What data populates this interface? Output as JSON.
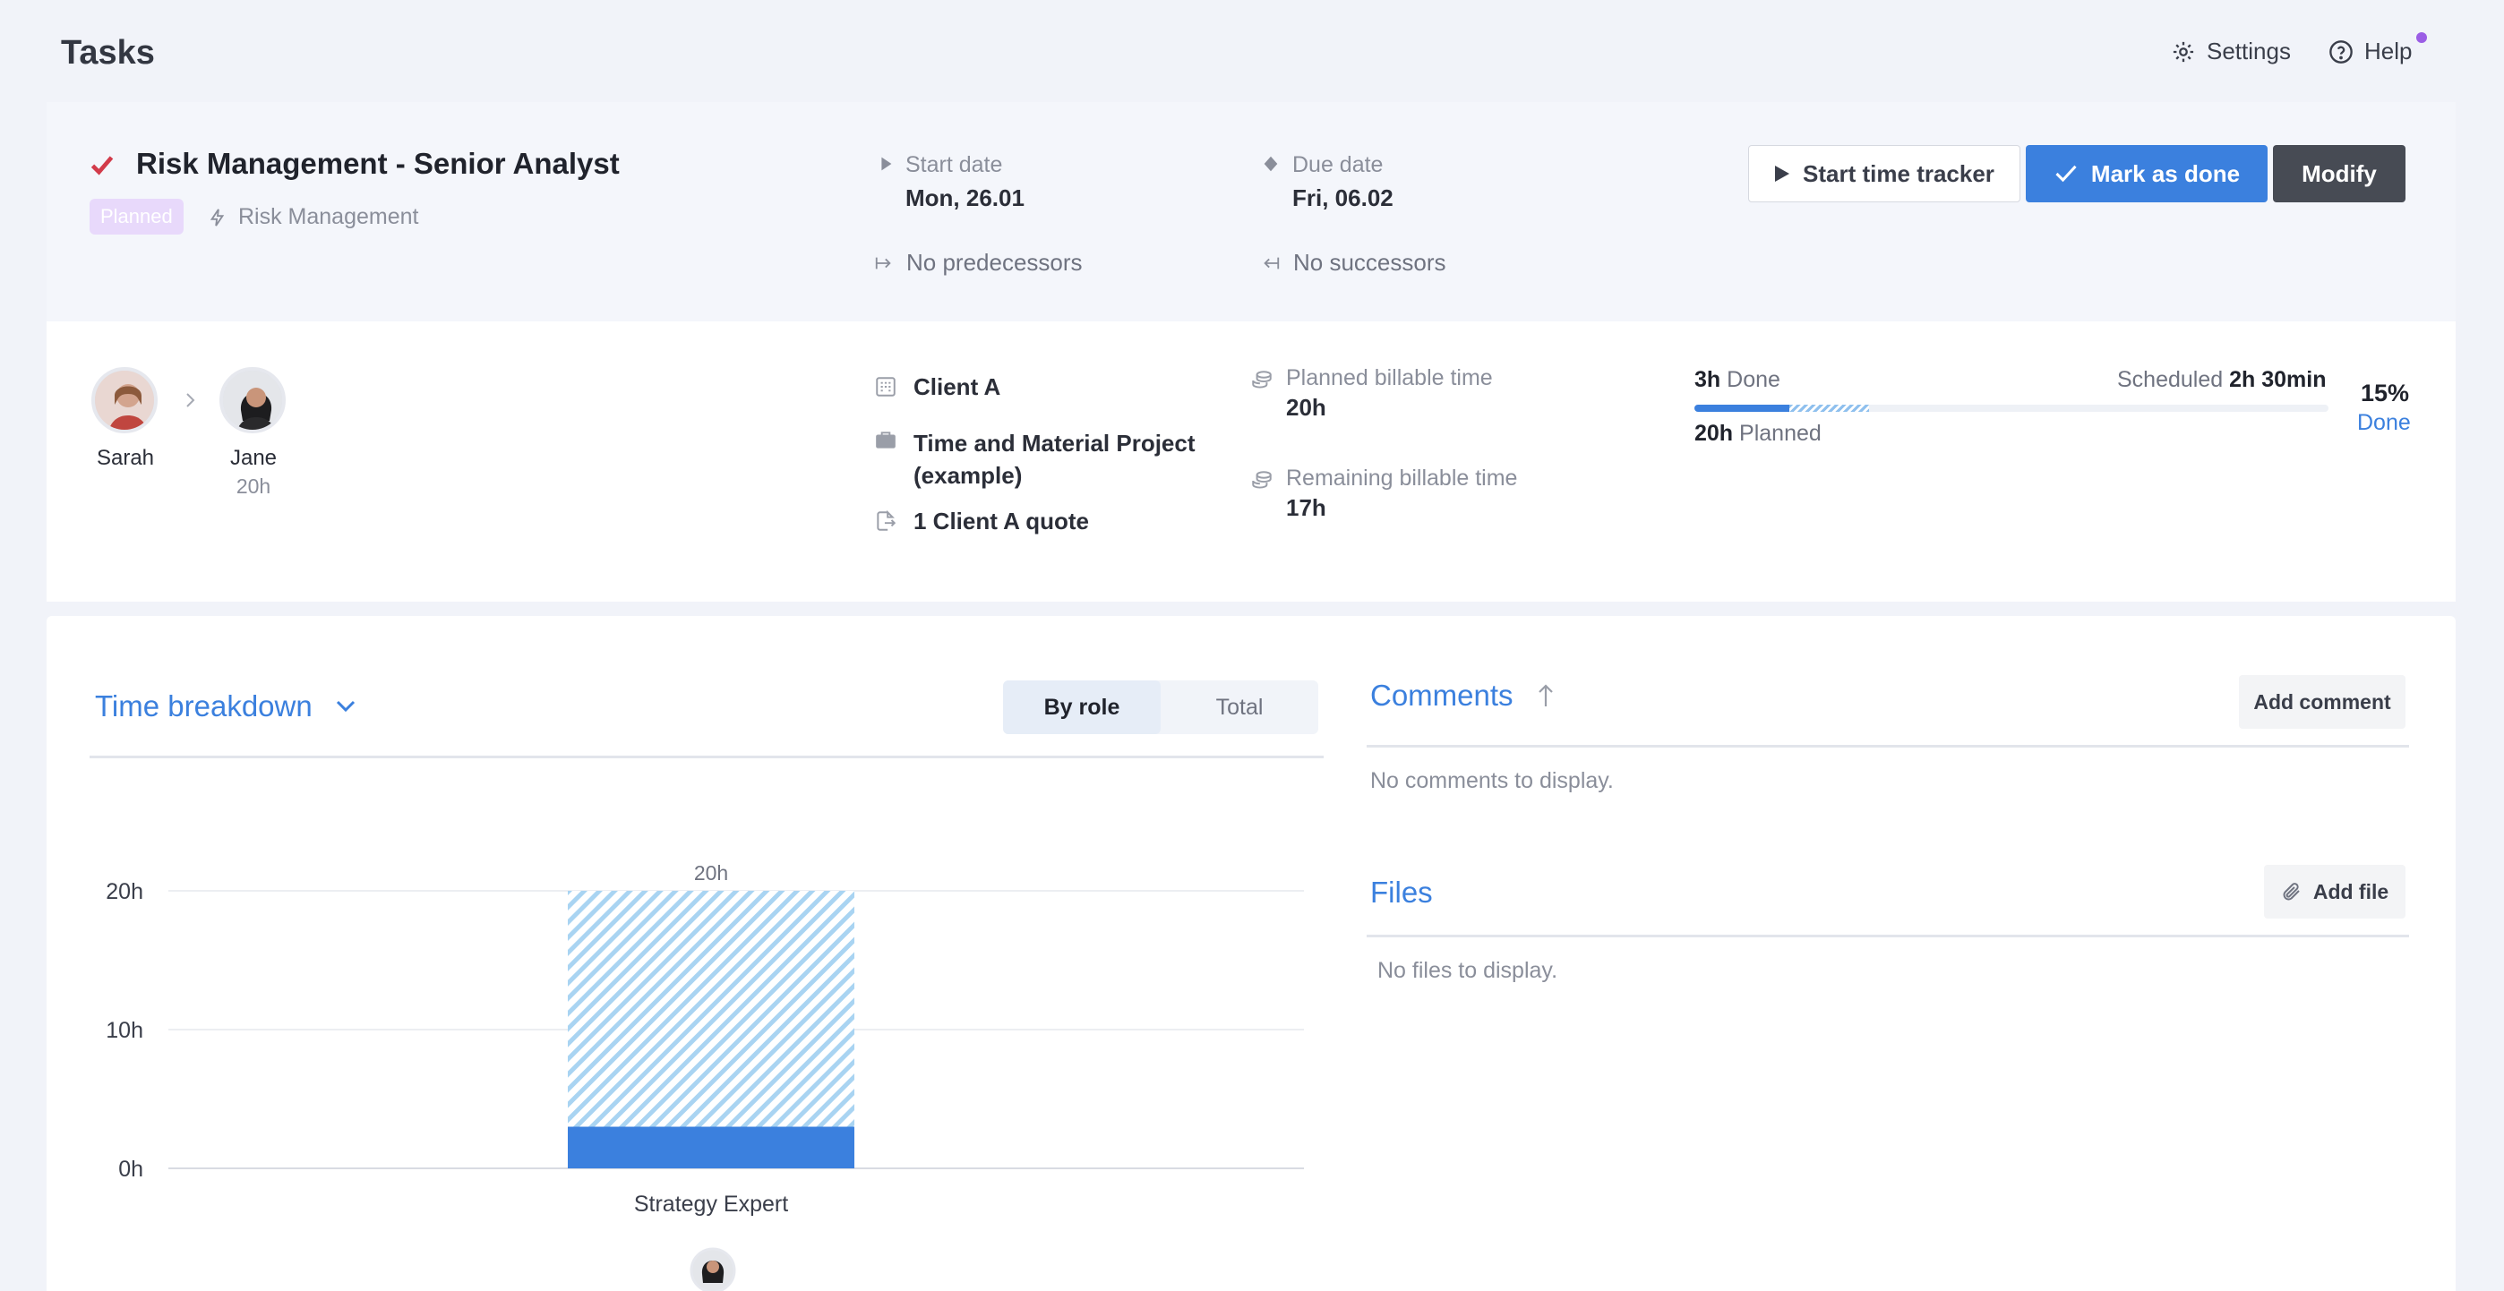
{
  "app": {
    "title": "Tasks",
    "settings_label": "Settings",
    "help_label": "Help"
  },
  "task": {
    "title": "Risk Management - Senior Analyst",
    "status_badge": "Planned",
    "project": "Risk Management",
    "start_label": "Start date",
    "start_value": "Mon, 26.01",
    "due_label": "Due date",
    "due_value": "Fri, 06.02",
    "predecessors": "No predecessors",
    "successors": "No successors"
  },
  "actions": {
    "tracker_label": "Start time tracker",
    "done_label": "Mark as done",
    "modify_label": "Modify"
  },
  "people": [
    {
      "name": "Sarah",
      "hours": ""
    },
    {
      "name": "Jane",
      "hours": "20h"
    }
  ],
  "details": {
    "client": "Client A",
    "project_line1": "Time and Material Project",
    "project_line2": "(example)",
    "quote": "1 Client A quote",
    "planned_billable_label": "Planned billable time",
    "planned_billable_value": "20h",
    "remaining_billable_label": "Remaining billable time",
    "remaining_billable_value": "17h"
  },
  "progress": {
    "done_value": "3h",
    "done_label": "Done",
    "scheduled_label": "Scheduled",
    "scheduled_value": "2h 30min",
    "planned_value": "20h",
    "planned_label": "Planned",
    "percent": "15%",
    "percent_label": "Done",
    "done_fraction": 0.15,
    "scheduled_fraction": 0.125
  },
  "breakdown": {
    "title": "Time breakdown",
    "tab_role": "By role",
    "tab_total": "Total"
  },
  "chart_data": {
    "type": "bar",
    "categories": [
      "Strategy Expert"
    ],
    "series": [
      {
        "name": "Done",
        "values": [
          3
        ],
        "color": "#3b80de"
      },
      {
        "name": "Planned",
        "values": [
          20
        ],
        "color": "#a9d4f2"
      }
    ],
    "data_labels": [
      "20h"
    ],
    "yticks": [
      "0h",
      "10h",
      "20h"
    ],
    "ylim": [
      0,
      20
    ],
    "grid": true
  },
  "comments": {
    "title": "Comments",
    "add_label": "Add comment",
    "empty": "No comments to display."
  },
  "files": {
    "title": "Files",
    "add_label": "Add file",
    "empty": "No files to display."
  }
}
